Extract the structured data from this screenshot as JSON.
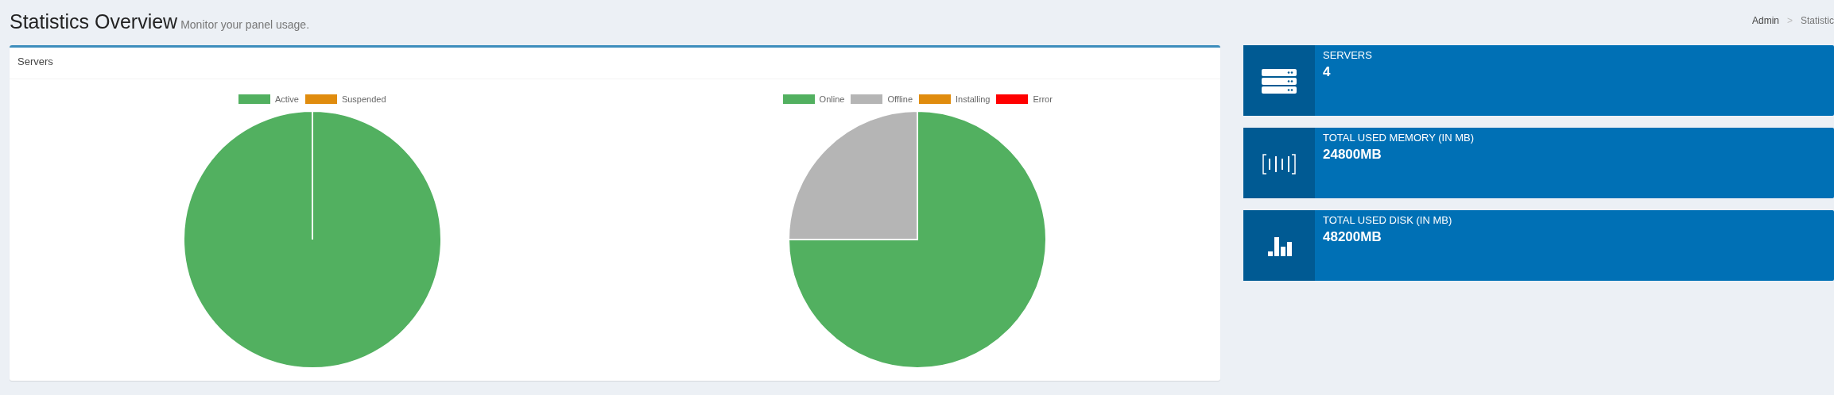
{
  "header": {
    "title": "Statistics Overview",
    "subtitle": "Monitor your panel usage.",
    "breadcrumb": [
      "Admin",
      "Statistic"
    ],
    "breadcrumb_separator": ">"
  },
  "servers_box": {
    "title": "Servers",
    "charts": [
      {
        "chart_data": {
          "type": "pie",
          "categories": [
            "Active",
            "Suspended"
          ],
          "legend": "top",
          "values": [
            100,
            0
          ],
          "colors": [
            "#52b060",
            "#e08c0e"
          ]
        }
      },
      {
        "chart_data": {
          "type": "pie",
          "categories": [
            "Online",
            "Offline",
            "Installing",
            "Error"
          ],
          "legend": "top",
          "values": [
            75,
            25,
            0,
            0
          ],
          "colors": [
            "#52b060",
            "#b5b5b5",
            "#e08c0e",
            "#ff0000"
          ]
        }
      }
    ]
  },
  "stat_cards": [
    {
      "kind": "servers",
      "label": "SERVERS",
      "value": "4"
    },
    {
      "kind": "memory",
      "label": "TOTAL USED MEMORY (IN MB)",
      "value": "24800MB"
    },
    {
      "kind": "disk",
      "label": "TOTAL USED DISK (IN MB)",
      "value": "48200MB"
    }
  ]
}
